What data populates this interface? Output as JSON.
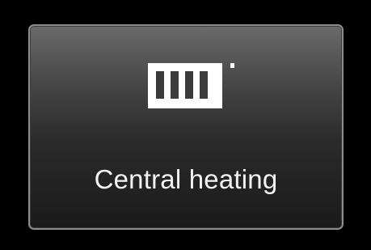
{
  "tile": {
    "label": "Central heating",
    "icon": "radiator-icon"
  },
  "colors": {
    "background": "#000000",
    "tile_border": "#8c8c8c",
    "text": "#f2f2f2",
    "icon": "#ffffff"
  }
}
